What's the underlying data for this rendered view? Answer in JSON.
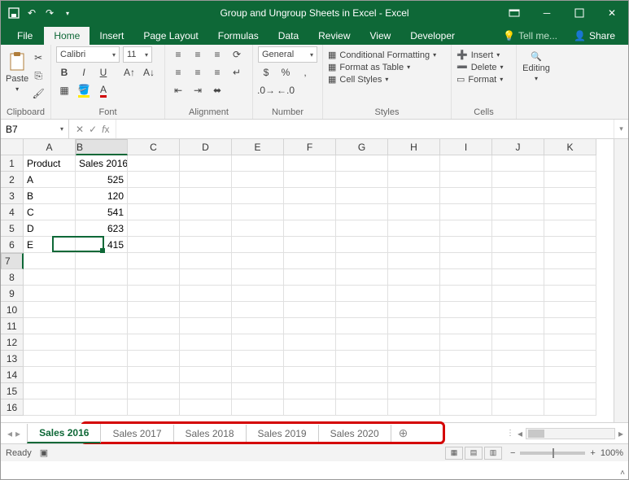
{
  "title": "Group and Ungroup Sheets in Excel - Excel",
  "ribbon_tabs": {
    "file": "File",
    "items": [
      "Home",
      "Insert",
      "Page Layout",
      "Formulas",
      "Data",
      "Review",
      "View",
      "Developer"
    ],
    "active": "Home",
    "tell_me": "Tell me...",
    "share": "Share"
  },
  "ribbon": {
    "clipboard": {
      "label": "Clipboard",
      "paste": "Paste"
    },
    "font": {
      "label": "Font",
      "name": "Calibri",
      "size": "11"
    },
    "alignment": {
      "label": "Alignment"
    },
    "number": {
      "label": "Number",
      "format": "General"
    },
    "styles": {
      "label": "Styles",
      "cond": "Conditional Formatting",
      "table": "Format as Table",
      "cell": "Cell Styles"
    },
    "cells": {
      "label": "Cells",
      "insert": "Insert",
      "delete": "Delete",
      "format": "Format"
    },
    "editing": {
      "label": "Editing"
    }
  },
  "namebox": "B7",
  "formula": "",
  "columns": [
    "A",
    "B",
    "C",
    "D",
    "E",
    "F",
    "G",
    "H",
    "I",
    "J",
    "K"
  ],
  "rows": 16,
  "active": {
    "col": 1,
    "row": 6
  },
  "chart_data": {
    "type": "table",
    "headers": [
      "Product",
      "Sales 2016"
    ],
    "rows": [
      [
        "A",
        525
      ],
      [
        "B",
        120
      ],
      [
        "C",
        541
      ],
      [
        "D",
        623
      ],
      [
        "E",
        415
      ]
    ]
  },
  "sheet_tabs": [
    "Sales 2016",
    "Sales 2017",
    "Sales 2018",
    "Sales 2019",
    "Sales 2020"
  ],
  "active_sheet": 0,
  "status": {
    "ready": "Ready",
    "zoom": "100%"
  }
}
